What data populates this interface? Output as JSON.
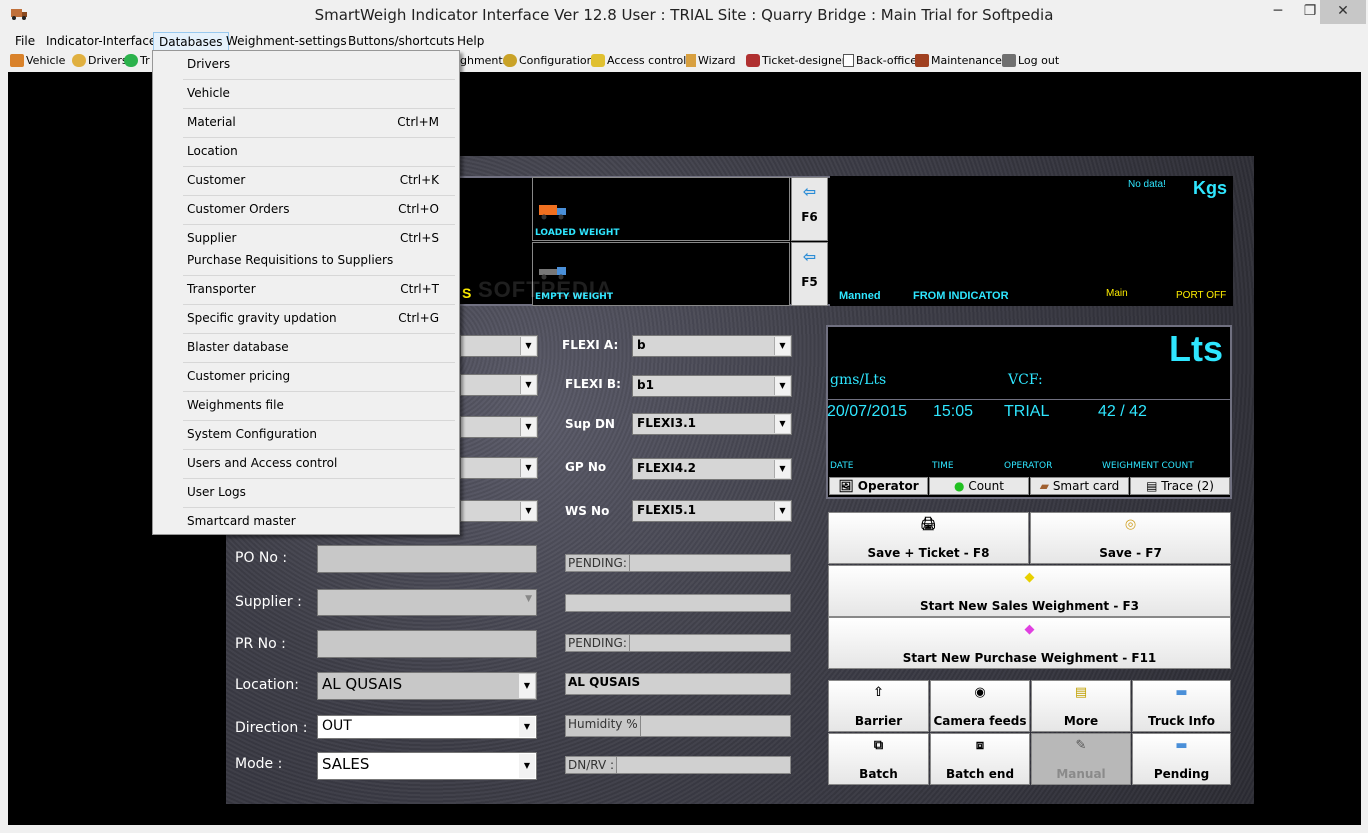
{
  "window": {
    "title": "SmartWeigh Indicator Interface Ver 12.8     User : TRIAL     Site : Quarry     Bridge : Main     Trial for Softpedia",
    "minimize": "─",
    "maximize": "❐",
    "close": "✕"
  },
  "menu": [
    "File",
    "Indicator-Interface",
    "Databases",
    "Weighment-settings",
    "Buttons/shortcuts",
    "Help"
  ],
  "toolbar": {
    "vehicle": "Vehicle",
    "drivers": "Drivers",
    "tr": "Tr",
    "weighments": "ghments",
    "configuration": "Configuration",
    "access_control": "Access control",
    "wizard": "Wizard",
    "ticket_designer": "Ticket-designer",
    "back_office": "Back-office",
    "maintenance": "Maintenance",
    "log_out": "Log out"
  },
  "databases_menu": [
    {
      "label": "Drivers",
      "shortcut": ""
    },
    {
      "label": "Vehicle",
      "shortcut": ""
    },
    {
      "label": "Material",
      "shortcut": "Ctrl+M"
    },
    {
      "label": "Location",
      "shortcut": ""
    },
    {
      "label": "Customer",
      "shortcut": "Ctrl+K"
    },
    {
      "label": "Customer Orders",
      "shortcut": "Ctrl+O"
    },
    {
      "label": "Supplier",
      "shortcut": "Ctrl+S"
    },
    {
      "label": "Purchase Requisitions to Suppliers",
      "shortcut": ""
    },
    {
      "label": "Transporter",
      "shortcut": "Ctrl+T"
    },
    {
      "label": "Specific gravity updation",
      "shortcut": "Ctrl+G"
    },
    {
      "label": "Blaster database",
      "shortcut": ""
    },
    {
      "label": "Customer pricing",
      "shortcut": ""
    },
    {
      "label": "Weighments file",
      "shortcut": ""
    },
    {
      "label": "System Configuration",
      "shortcut": ""
    },
    {
      "label": "Users and Access control",
      "shortcut": ""
    },
    {
      "label": "User Logs",
      "shortcut": ""
    },
    {
      "label": "Smartcard master",
      "shortcut": ""
    }
  ],
  "weight": {
    "loaded_weight": "LOADED WEIGHT",
    "empty_weight": "EMPTY WEIGHT",
    "f6": "F6",
    "f5": "F5",
    "no_data": "No data!",
    "unit": "Kgs",
    "manned": "Manned",
    "from_indicator": "FROM INDICATOR",
    "main": "Main",
    "port_off": "PORT OFF",
    "partial_s": "S",
    "watermark": "SOFTPEDIA"
  },
  "info": {
    "lts": "Lts",
    "gms_lts": "gms/Lts",
    "vcf": "VCF:",
    "date": "20/07/2015",
    "time": "15:05",
    "operator": "TRIAL",
    "count": "42 / 42",
    "date_lbl": "DATE",
    "time_lbl": "TIME",
    "operator_lbl": "OPERATOR",
    "count_lbl": "WEIGHMENT COUNT",
    "tabs": [
      "Operator",
      "Count",
      "Smart card",
      "Trace (2)"
    ]
  },
  "flexi": [
    {
      "label": "FLEXI A:",
      "value": "b"
    },
    {
      "label": "FLEXI B:",
      "value": "b1"
    },
    {
      "label": "Sup DN",
      "value": "FLEXI3.1"
    },
    {
      "label": "GP No",
      "value": "FLEXI4.2"
    },
    {
      "label": "WS No",
      "value": "FLEXI5.1"
    }
  ],
  "form": {
    "po_no": "PO No   :",
    "supplier": "Supplier  :",
    "pr_no": "PR No   :",
    "location": "Location:",
    "location_value": "AL QUSAIS",
    "direction": "Direction :",
    "direction_value": "OUT",
    "mode": "Mode    :",
    "mode_value": "SALES",
    "pending": "PENDING:",
    "location_text": "AL QUSAIS",
    "humidity": "Humidity %",
    "dn_rv": "DN/RV  :"
  },
  "actions": {
    "save_ticket": "Save + Ticket - F8",
    "save": "Save - F7",
    "start_sales": "Start New Sales Weighment - F3",
    "start_purchase": "Start New Purchase Weighment - F11",
    "barrier": "Barrier",
    "camera": "Camera feeds",
    "more": "More",
    "truck_info": "Truck Info",
    "batch": "Batch",
    "batch_end": "Batch end",
    "manual": "Manual",
    "pending": "Pending"
  }
}
